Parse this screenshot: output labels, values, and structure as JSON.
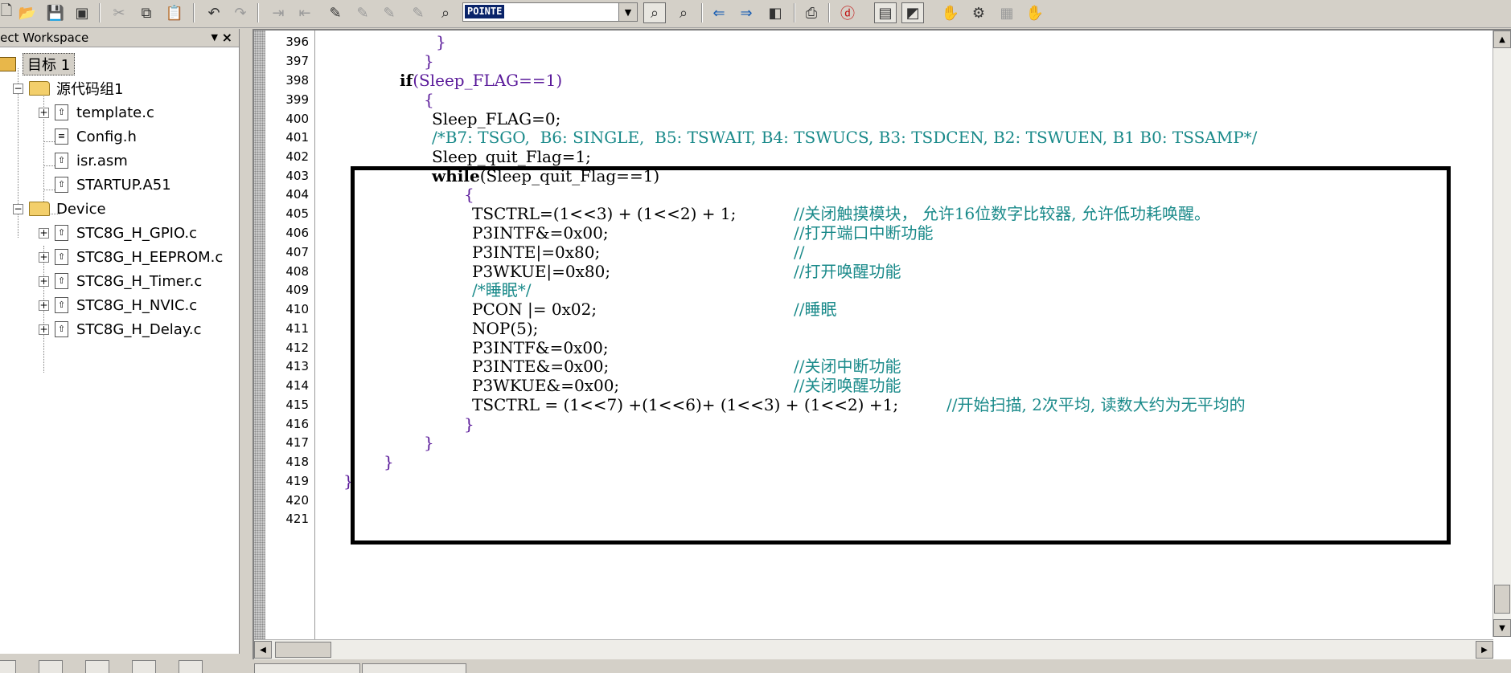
{
  "toolbar": {
    "combo_value": "POINTE",
    "icons": [
      "new-file-icon",
      "open-folder-icon",
      "save-icon",
      "save-all-icon",
      "cut-icon",
      "copy-icon",
      "paste-icon",
      "undo-icon",
      "redo-icon",
      "indent-icon",
      "unindent-icon",
      "bookmark-icon",
      "next-bookmark-icon",
      "prev-bookmark-icon",
      "clear-bookmarks-icon",
      "find-in-files-icon",
      "find-icon",
      "incremental-find-icon",
      "back-icon",
      "forward-icon",
      "browse-icon",
      "print-icon",
      "debug-icon",
      "workspace-toggle-icon",
      "output-toggle-icon",
      "hand-icon",
      "build-icon",
      "rebuild-icon",
      "stop-icon"
    ]
  },
  "workspace": {
    "title": "ject Workspace",
    "tree": {
      "target": "目标 1",
      "groups": [
        {
          "name": "源代码组1",
          "files": [
            "template.c",
            "Config.h",
            "isr.asm",
            "STARTUP.A51"
          ]
        },
        {
          "name": "Device",
          "files": [
            "STC8G_H_GPIO.c",
            "STC8G_H_EEPROM.c",
            "STC8G_H_Timer.c",
            "STC8G_H_NVIC.c",
            "STC8G_H_Delay.c"
          ]
        }
      ]
    }
  },
  "editor": {
    "line_numbers": [
      "396",
      "397",
      "398",
      "399",
      "400",
      "401",
      "402",
      "403",
      "404",
      "405",
      "406",
      "407",
      "408",
      "409",
      "410",
      "411",
      "412",
      "413",
      "414",
      "415",
      "416",
      "417",
      "418",
      "419",
      "420",
      "421"
    ],
    "code": {
      "l396": "}",
      "l397": "}",
      "l398_kw": "if",
      "l398_rest": "(Sleep_FLAG==1)",
      "l399": "{",
      "l400": "Sleep_FLAG=0;",
      "l401": "/*B7: TSGO,  B6: SINGLE,  B5: TSWAIT, B4: TSWUCS, B3: TSDCEN, B2: TSWUEN, B1 B0: TSSAMP*/",
      "l402": "Sleep_quit_Flag=1;",
      "l403_kw": "while",
      "l403_rest": "(Sleep_quit_Flag==1)",
      "l404": "{",
      "l405_code": "TSCTRL=(1<<3) + (1<<2) + 1;",
      "l405_cm": "//关闭触摸模块， 允许16位数字比较器, 允许低功耗唤醒。",
      "l406_code": "P3INTF&=0x00;",
      "l406_cm": "//打开端口中断功能",
      "l407_code": "P3INTE|=0x80;",
      "l407_cm": "//",
      "l408_code": "P3WKUE|=0x80;",
      "l408_cm": "//打开唤醒功能",
      "l409": "/*睡眠*/",
      "l410_code": "PCON |= 0x02;",
      "l410_cm": "//睡眠",
      "l411": "NOP(5);",
      "l412": "P3INTF&=0x00;",
      "l413_code": "P3INTE&=0x00;",
      "l413_cm": "//关闭中断功能",
      "l414_code": "P3WKUE&=0x00;",
      "l414_cm": "//关闭唤醒功能",
      "l415_code": "TSCTRL = (1<<7) +(1<<6)+ (1<<3) + (1<<2) +1;",
      "l415_cm": "//开始扫描, 2次平均, 读数大约为无平均的",
      "l416": "}",
      "l417": "}",
      "l418": "}",
      "l419": "}"
    }
  }
}
